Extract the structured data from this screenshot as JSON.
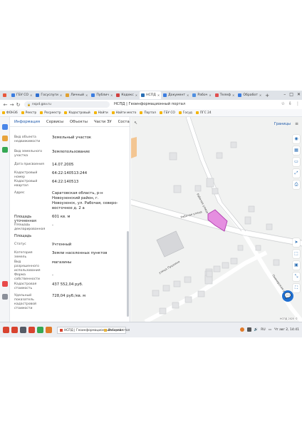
{
  "browser": {
    "tabs": [
      {
        "label": "ГБУ СО",
        "color": "#3b7de0"
      },
      {
        "label": "Госуслуги",
        "color": "#2f6fd0"
      },
      {
        "label": "Личный",
        "color": "#e0a030"
      },
      {
        "label": "Публич",
        "color": "#3b7de0"
      },
      {
        "label": "Кодекс",
        "color": "#d04040"
      },
      {
        "label": "НСПД",
        "color": "#2a6fb5",
        "active": true
      },
      {
        "label": "Документ",
        "color": "#3b7de0"
      },
      {
        "label": "Рабоч",
        "color": "#5090e0"
      },
      {
        "label": "Телеф",
        "color": "#e05050"
      },
      {
        "label": "Обработ",
        "color": "#3b7de0"
      }
    ],
    "url": "nspd.gov.ru",
    "page_title": "НСПД | Геоинформационный портал",
    "bookmarks": [
      "ФОН36",
      "Реестр",
      "Росреестр",
      "Кадастровый",
      "Найти",
      "Найти место",
      "Портал",
      "ГБУ СО",
      "Госуд",
      "ПГС 24"
    ]
  },
  "panel": {
    "tabs": [
      "Информация",
      "Сервисы",
      "Объекты",
      "Части ЗУ",
      "Состав"
    ],
    "close_icon": "close-icon",
    "rows": [
      {
        "label": "Вид объекта недвижимости",
        "value": "Земельный участок"
      },
      {
        "label": "Вид земельного участка",
        "value": "Землепользование"
      },
      {
        "label": "Дата присвоения",
        "value": "14.07.2005"
      },
      {
        "label": "Кадастровый номер",
        "value": "64:22:140513:244"
      },
      {
        "label": "Кадастровый квартал",
        "value": "64:22:140513"
      },
      {
        "label": "Адрес",
        "value": "Саратовская область, р-н Новоузенский район, г. Новоузенск, ул. Рабочая, северо-восточнее д. 2 а"
      },
      {
        "label": "Площадь уточненная",
        "value": "601 кв. м",
        "bold": true
      },
      {
        "label": "Площадь декларированная",
        "value": "-"
      },
      {
        "label": "Площадь",
        "value": "",
        "bold": true
      },
      {
        "label": "Статус",
        "value": "Учтенный"
      },
      {
        "label": "Категория земель",
        "value": "Земли населенных пунктов"
      },
      {
        "label": "Вид разрешенного использования",
        "value": "магазины"
      },
      {
        "label": "Форма собственности",
        "value": "-"
      },
      {
        "label": "Кадастровая стоимость",
        "value": "437 552,04 руб."
      },
      {
        "label": "Удельный показатель кадастровой стоимости",
        "value": "728,04 руб./кв. м"
      }
    ]
  },
  "map": {
    "border_label": "Границы",
    "streets": [
      "Рабочая улица",
      "Рабочая улица",
      "улица Пушкина",
      "Пионерская улица"
    ],
    "tools": [
      "geo-icon",
      "layers-icon",
      "ruler-icon",
      "share-icon",
      "print-icon"
    ],
    "bottom_tools": [
      "navigation-icon",
      "select-icon",
      "screen-icon",
      "expand-icon",
      "fullscreen-icon"
    ],
    "scale_text": "НСПД 2025 ©",
    "parcel_color": "#e58ee0"
  },
  "taskbar": {
    "active_task": "НСПД | Геоинформационный портал",
    "folder_task": "Рабочий стол",
    "lang": "RU",
    "time": "Чт авг 2, 14:41"
  }
}
